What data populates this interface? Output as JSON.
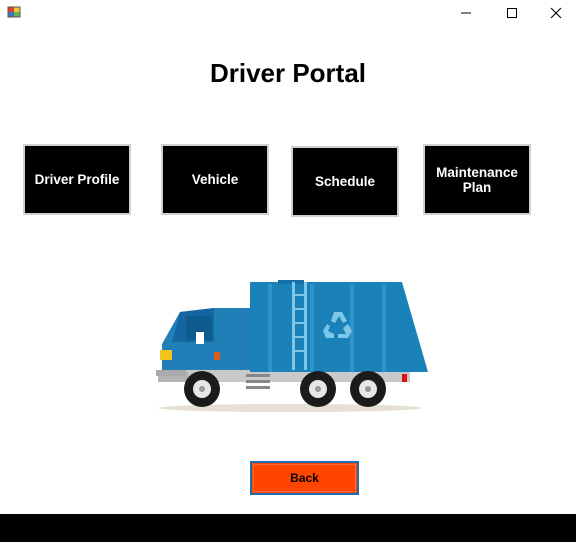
{
  "window": {
    "icon": "app-icon",
    "controls": [
      "minimize-icon",
      "maximize-icon",
      "close-icon"
    ]
  },
  "page": {
    "title": "Driver Portal"
  },
  "nav": {
    "driver_profile": "Driver Profile",
    "vehicle": "Vehicle",
    "schedule": "Schedule",
    "maintenance_line1": "Maintenance",
    "maintenance_line2": "Plan"
  },
  "illustration": {
    "icon": "garbage-truck-icon",
    "body_color": "#1a82b8",
    "recycle_color": "#7cc6e8"
  },
  "actions": {
    "back_label": "Back",
    "back_color": "#ff4500"
  }
}
